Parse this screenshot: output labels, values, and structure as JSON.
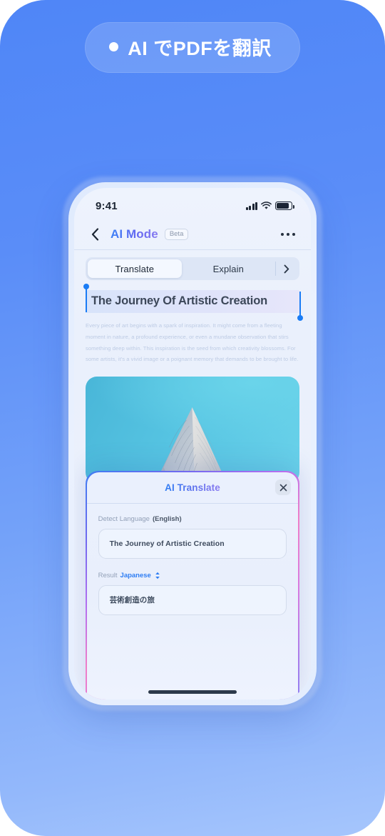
{
  "promo": {
    "badge_text": "AI でPDFを翻訳",
    "badge_dot": "dot-icon"
  },
  "statusbar": {
    "time": "9:41",
    "signal_icon": "cellular-signal-icon",
    "wifi_icon": "wifi-icon",
    "battery_icon": "battery-icon"
  },
  "navbar": {
    "back_icon": "chevron-left-icon",
    "title": "AI Mode",
    "badge": "Beta",
    "more_icon": "more-horizontal-icon"
  },
  "tabs": {
    "items": [
      {
        "label": "Translate",
        "active": true
      },
      {
        "label": "Explain",
        "active": false
      }
    ],
    "arrow_icon": "chevron-right-icon"
  },
  "document": {
    "title": "The Journey Of Artistic Creation",
    "body": "Every piece of art begins with a spark of inspiration. It might come from a fleeting moment in nature, a profound experience, or even a mundane observation that stirs something deep within. This inspiration is the seed from which creativity blossoms. For some artists, it's a vivid image or a poignant memory that demands to be brought to life.",
    "image_alt": "mountain-peak-photo"
  },
  "modal": {
    "title": "AI Translate",
    "close_icon": "close-icon",
    "source": {
      "label_prefix": "Detect Language ",
      "label_value": "(English)",
      "text": "The Journey of Artistic Creation"
    },
    "result": {
      "label_prefix": "Result",
      "language": "Japanese",
      "selector_icon": "up-down-chevron-icon",
      "text": "芸術創造の旅"
    }
  },
  "home_indicator": "home-indicator",
  "colors": {
    "background_top": "#4f86f7",
    "background_bottom": "#a6c6fc",
    "accent_blue": "#2f7ef3",
    "accent_purple": "#8b7bf0",
    "accent_pink": "#f07ec8",
    "selection_blue": "#1a7cf5",
    "image_sky": "#56c4e2",
    "text_dark": "#1c2533",
    "text_muted": "#93a1b8"
  }
}
